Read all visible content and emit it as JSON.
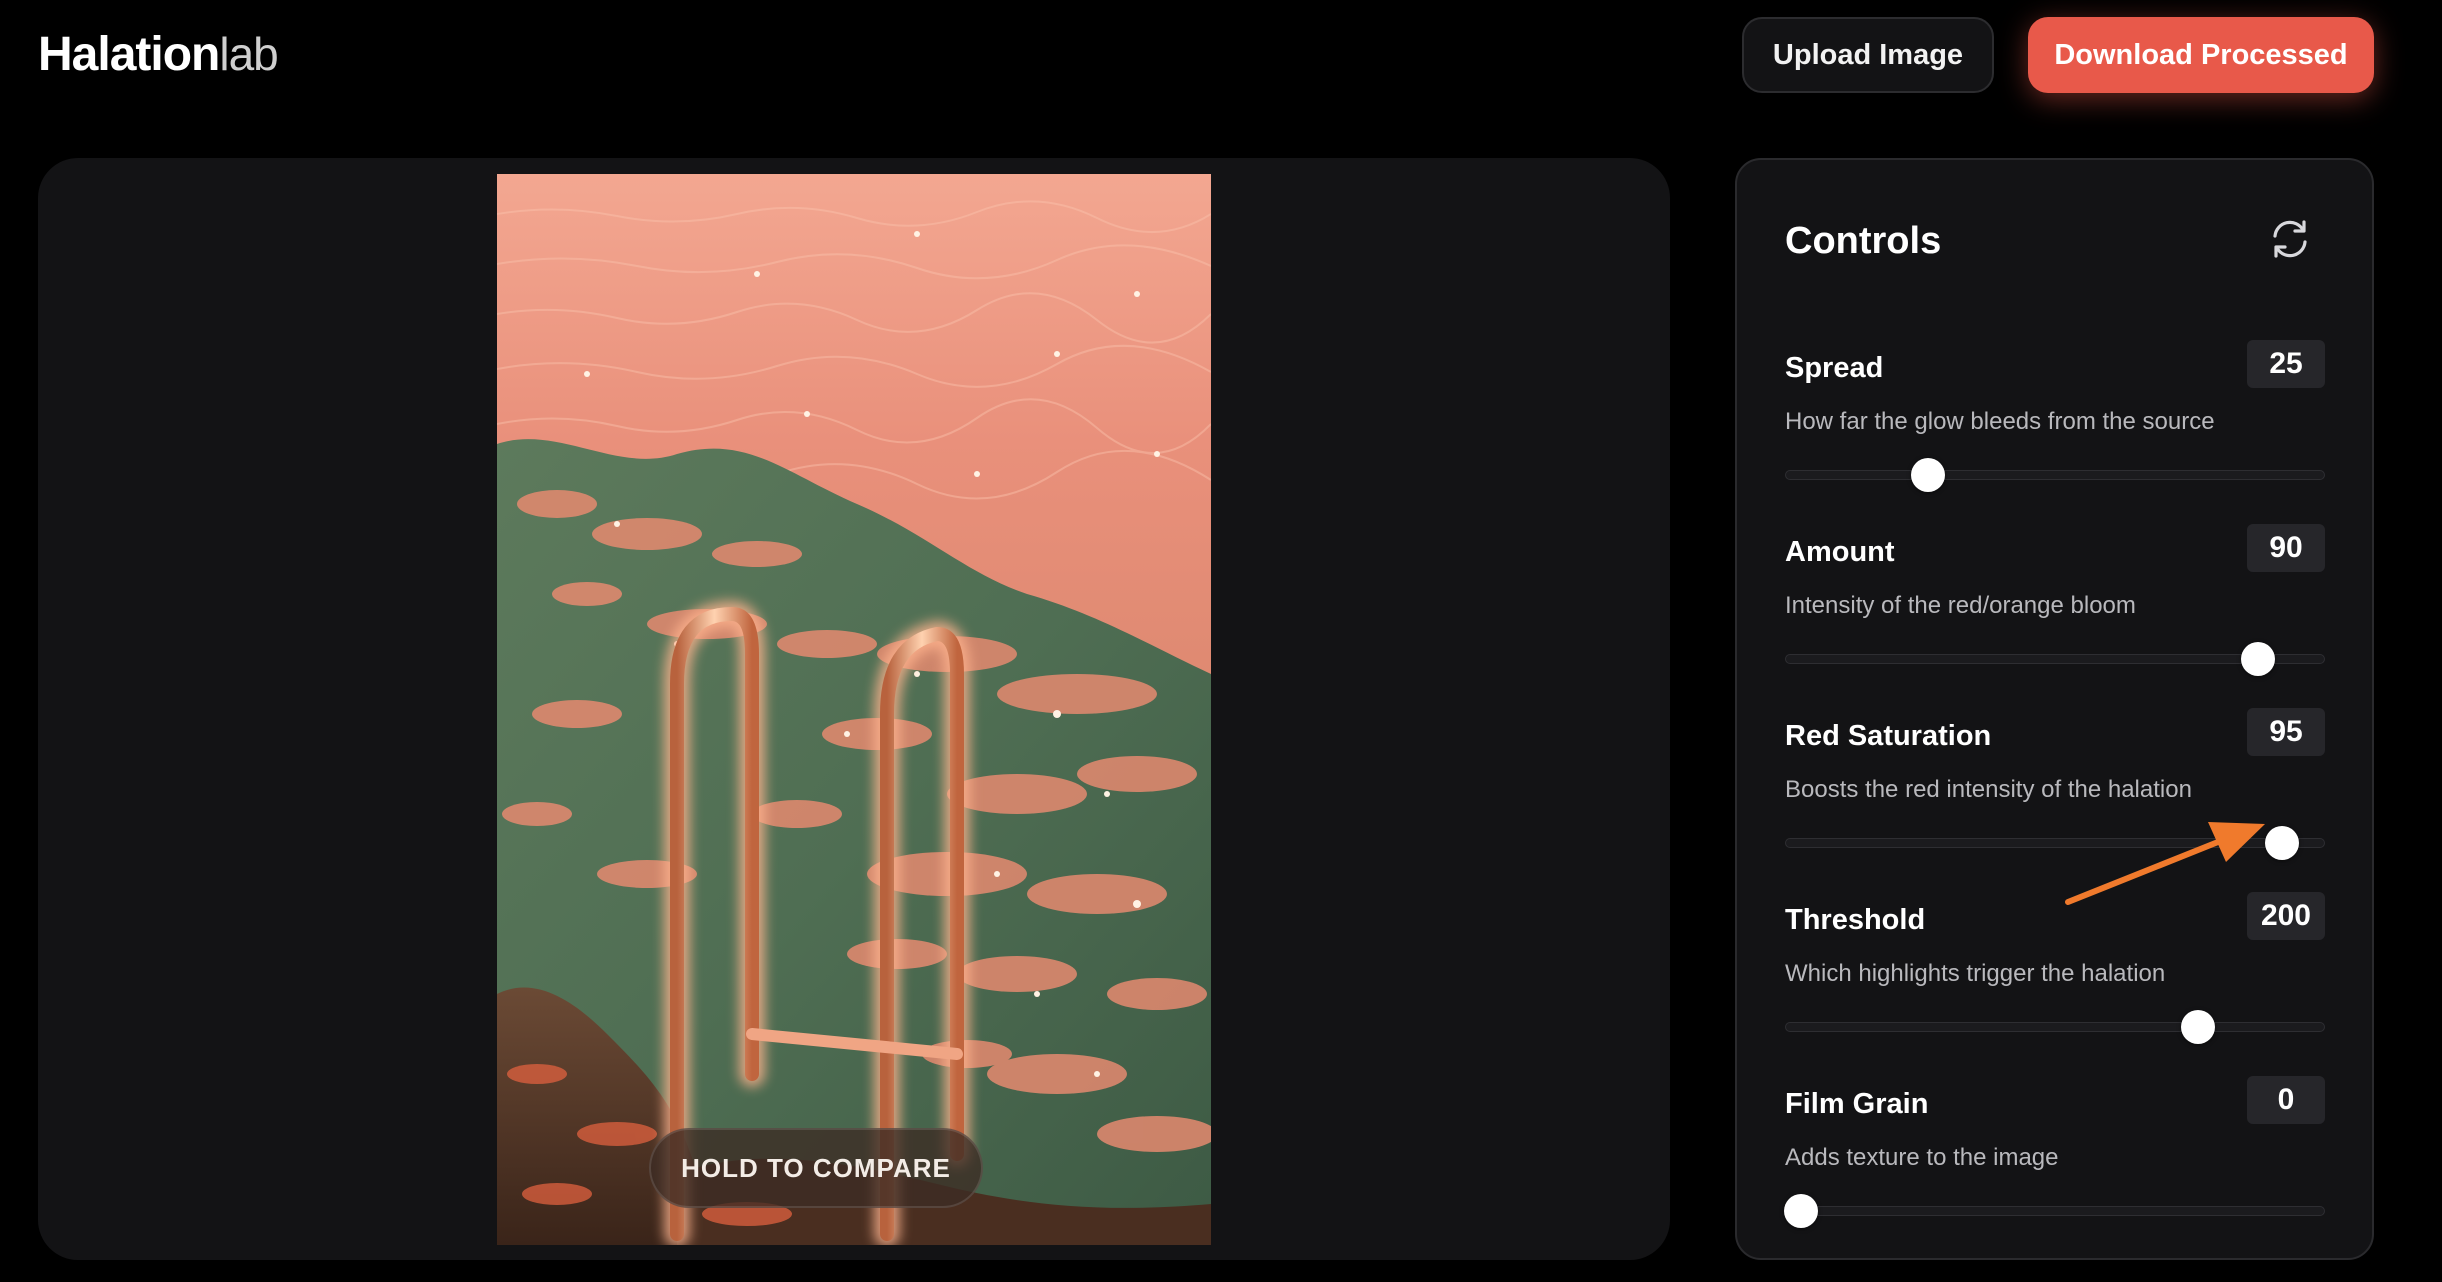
{
  "header": {
    "logo_main": "Halation",
    "logo_sub": "lab",
    "upload_label": "Upload Image",
    "download_label": "Download Processed"
  },
  "preview": {
    "compare_label": "HOLD TO COMPARE"
  },
  "controls": {
    "title": "Controls",
    "reset_icon": "reset-icon",
    "sliders": [
      {
        "label": "Spread",
        "value": "25",
        "description": "How far the glow bleeds from the source",
        "position": 0.265
      },
      {
        "label": "Amount",
        "value": "90",
        "description": "Intensity of the red/orange bloom",
        "position": 0.875
      },
      {
        "label": "Red Saturation",
        "value": "95",
        "description": "Boosts the red intensity of the halation",
        "position": 0.92
      },
      {
        "label": "Threshold",
        "value": "200",
        "description": "Which highlights trigger the halation",
        "position": 0.765
      },
      {
        "label": "Film Grain",
        "value": "0",
        "description": "Adds texture to the image",
        "position": 0.03
      }
    ]
  },
  "colors": {
    "accent": "#e8594a",
    "annotation_arrow": "#f07a2c",
    "panel": "#131315"
  }
}
